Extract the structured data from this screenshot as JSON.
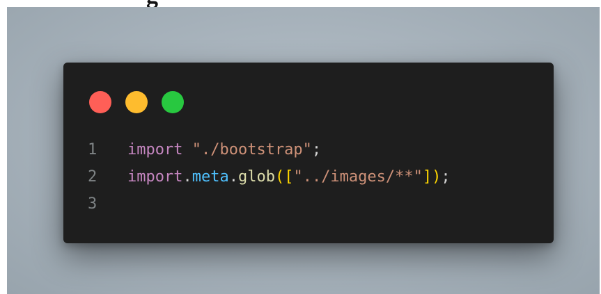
{
  "window": {
    "dots": [
      {
        "name": "close",
        "color": "#ff5f57"
      },
      {
        "name": "minimize",
        "color": "#febc2e"
      },
      {
        "name": "maximize",
        "color": "#28c840"
      }
    ]
  },
  "code": {
    "lines": [
      {
        "number": "1",
        "tokens": [
          {
            "text": "import",
            "color": "#c586c0"
          },
          {
            "text": " ",
            "color": "#d4d4d4"
          },
          {
            "text": "\"./bootstrap\"",
            "color": "#ce9178"
          },
          {
            "text": ";",
            "color": "#d4d4d4"
          }
        ]
      },
      {
        "number": "2",
        "tokens": [
          {
            "text": "import",
            "color": "#c586c0"
          },
          {
            "text": ".",
            "color": "#d4d4d4"
          },
          {
            "text": "meta",
            "color": "#4fc1ff"
          },
          {
            "text": ".",
            "color": "#d4d4d4"
          },
          {
            "text": "glob",
            "color": "#dcdcaa"
          },
          {
            "text": "([",
            "color": "#ffd700"
          },
          {
            "text": "\"../images/**\"",
            "color": "#ce9178"
          },
          {
            "text": "])",
            "color": "#ffd700"
          },
          {
            "text": ";",
            "color": "#d4d4d4"
          }
        ]
      },
      {
        "number": "3",
        "tokens": []
      }
    ]
  }
}
